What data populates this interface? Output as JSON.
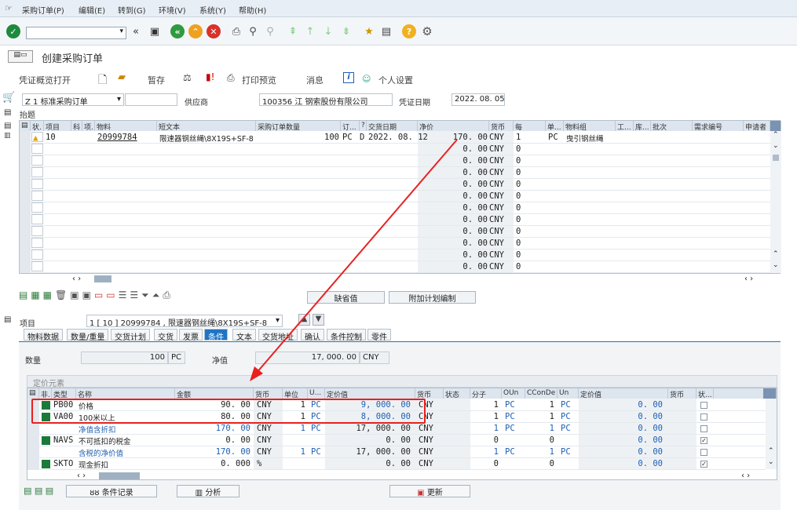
{
  "menu": [
    "采购订单(P)",
    "编辑(E)",
    "转到(G)",
    "环境(V)",
    "系统(Y)",
    "帮助(H)"
  ],
  "title": "创建采购订单",
  "app_toolbar": {
    "doc_overview": "凭证概览打开",
    "hold": "暂存",
    "print_preview": "打印预览",
    "messages": "消息",
    "personal_settings": "个人设置"
  },
  "header": {
    "po_type": "Z 1 标准采购订单",
    "vendor_label": "供应商",
    "vendor": "100356 江   钢索股份有限公司",
    "doc_date_label": "凭证日期",
    "doc_date": "2022. 08. 05"
  },
  "section_header": "抬题",
  "items_grid": {
    "columns": [
      "状.",
      "项目",
      "科",
      "项.",
      "物料",
      "短文本",
      "采购订单数量",
      "订...",
      "?",
      "交货日期",
      "净价",
      "货币",
      "每",
      "单...",
      "物料组",
      "工...",
      "库...",
      "批次",
      "需求编号",
      "申请者"
    ],
    "row1": {
      "item": "10",
      "material": "20999784",
      "short_text": "限速器钢丝绳\\8X19S+SF-8",
      "qty": "100",
      "unit": "PC",
      "cat": "D",
      "date": "2022. 08. 12",
      "price": "170. 00",
      "currency": "CNY",
      "per": "1",
      "ou": "PC",
      "mat_group": "曳引钢丝绳"
    },
    "empty_price": "0. 00",
    "empty_currency": "CNY",
    "empty_per": "0"
  },
  "buttons": {
    "default_values": "缺省值",
    "additional_planning": "附加计划编制"
  },
  "item_detail": {
    "label": "项目",
    "selector": "1 [ 10 ] 20999784 , 限速器钢丝绳\\8X19S+SF-8"
  },
  "tabs": [
    "物料数据",
    "数量/重量",
    "交货计划",
    "交货",
    "发票",
    "条件",
    "文本",
    "交货地址",
    "确认",
    "条件控制",
    "零件"
  ],
  "active_tab": "条件",
  "qty_section": {
    "qty_label": "数量",
    "qty": "100",
    "qty_unit": "PC",
    "net_label": "净值",
    "net": "17, 000. 00",
    "net_cur": "CNY"
  },
  "pricing_title": "定价元素",
  "cond_columns": [
    "非.",
    "类型",
    "名称",
    "金额",
    "货币",
    "单位",
    "U...",
    "定价值",
    "货币",
    "状态",
    "分子",
    "OUn",
    "CConDe",
    "Un",
    "定价值",
    "货币",
    "状..."
  ],
  "conditions": [
    {
      "type": "PB00",
      "name": "价格",
      "amount": "90. 00",
      "cur": "CNY",
      "per": "1",
      "unit": "PC",
      "value": "9, 000. 00",
      "vcur": "CNY",
      "num": "1",
      "oun": "PC",
      "den": "1",
      "un": "PC",
      "cval": "0. 00",
      "checked": false
    },
    {
      "type": "VA00",
      "name": "100米以上",
      "amount": "80. 00",
      "cur": "CNY",
      "per": "1",
      "unit": "PC",
      "value": "8, 000. 00",
      "vcur": "CNY",
      "num": "1",
      "oun": "PC",
      "den": "1",
      "un": "PC",
      "cval": "0. 00",
      "checked": false
    },
    {
      "type": "",
      "name": "净值含折扣",
      "amount": "170. 00",
      "cur": "CNY",
      "per": "1",
      "unit": "PC",
      "value": "17, 000. 00",
      "vcur": "CNY",
      "num": "1",
      "oun": "PC",
      "den": "1",
      "un": "PC",
      "cval": "0. 00",
      "checked": false
    },
    {
      "type": "NAVS",
      "name": "不可抵扣的税金",
      "amount": "0. 00",
      "cur": "CNY",
      "per": "",
      "unit": "",
      "value": "0. 00",
      "vcur": "CNY",
      "num": "0",
      "oun": "",
      "den": "0",
      "un": "",
      "cval": "0. 00",
      "checked": true
    },
    {
      "type": "",
      "name": "含税的净价值",
      "amount": "170. 00",
      "cur": "CNY",
      "per": "1",
      "unit": "PC",
      "value": "17, 000. 00",
      "vcur": "CNY",
      "num": "1",
      "oun": "PC",
      "den": "1",
      "un": "PC",
      "cval": "0. 00",
      "checked": false
    },
    {
      "type": "SKTO",
      "name": "现金折扣",
      "amount": "0. 000",
      "cur": "%",
      "per": "",
      "unit": "",
      "value": "0. 00",
      "vcur": "CNY",
      "num": "0",
      "oun": "",
      "den": "0",
      "un": "",
      "cval": "0. 00",
      "checked": true
    }
  ],
  "bottom_buttons": {
    "cond_record": "条件记录",
    "analysis": "分析",
    "update": "更新"
  },
  "colors": {
    "highlight": "#e8211f",
    "blue": "#1e5fb3",
    "tab_active": "#1e74c6",
    "green": "#1a7a3a"
  }
}
